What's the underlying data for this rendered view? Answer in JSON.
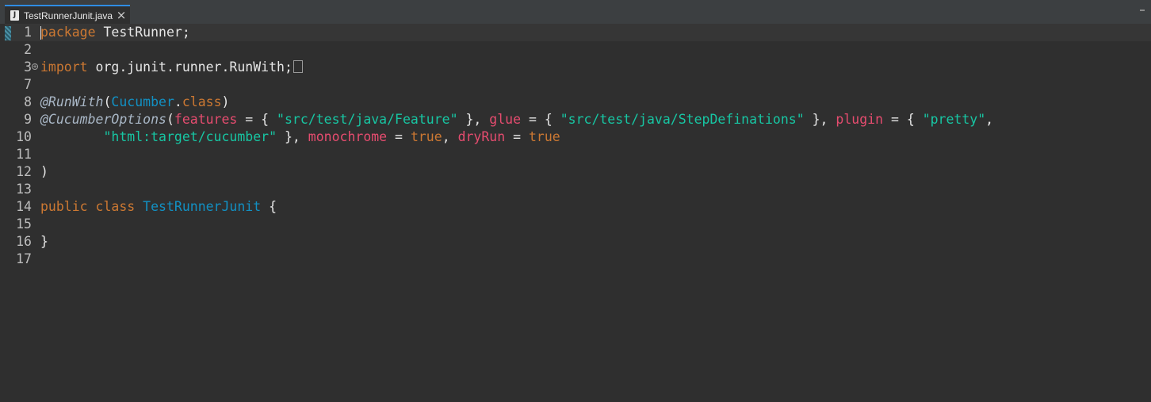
{
  "tab": {
    "title": "TestRunnerJunit.java",
    "icon": "J",
    "close": "×"
  },
  "editor": {
    "lines": [
      {
        "num": "1",
        "tokens": [
          [
            "kw",
            "package"
          ],
          [
            "txt",
            " TestRunner;"
          ]
        ]
      },
      {
        "num": "2",
        "tokens": []
      },
      {
        "num": "3",
        "folded": true,
        "tokens": [
          [
            "kw",
            "import"
          ],
          [
            "txt",
            " org.junit.runner.RunWith;"
          ]
        ]
      },
      {
        "num": "7",
        "tokens": []
      },
      {
        "num": "8",
        "tokens": [
          [
            "ann",
            "@RunWith"
          ],
          [
            "txt",
            "("
          ],
          [
            "type",
            "Cucumber"
          ],
          [
            "txt",
            "."
          ],
          [
            "kw",
            "class"
          ],
          [
            "txt",
            ")"
          ]
        ]
      },
      {
        "num": "9",
        "tokens": [
          [
            "ann",
            "@CucumberOptions"
          ],
          [
            "txt",
            "("
          ],
          [
            "param",
            "features"
          ],
          [
            "txt",
            " = { "
          ],
          [
            "str",
            "\"src/test/java/Feature\""
          ],
          [
            "txt",
            " }, "
          ],
          [
            "param",
            "glue"
          ],
          [
            "txt",
            " = { "
          ],
          [
            "str",
            "\"src/test/java/StepDefinations\""
          ],
          [
            "txt",
            " }, "
          ],
          [
            "param",
            "plugin"
          ],
          [
            "txt",
            " = { "
          ],
          [
            "str",
            "\"pretty\""
          ],
          [
            "txt",
            ","
          ]
        ]
      },
      {
        "num": "10",
        "tokens": [
          [
            "txt",
            "        "
          ],
          [
            "str",
            "\"html:target/cucumber\""
          ],
          [
            "txt",
            " }, "
          ],
          [
            "param",
            "monochrome"
          ],
          [
            "txt",
            " = "
          ],
          [
            "kw",
            "true"
          ],
          [
            "txt",
            ", "
          ],
          [
            "param",
            "dryRun"
          ],
          [
            "txt",
            " = "
          ],
          [
            "kw",
            "true"
          ]
        ]
      },
      {
        "num": "11",
        "tokens": []
      },
      {
        "num": "12",
        "tokens": [
          [
            "txt",
            ")"
          ]
        ]
      },
      {
        "num": "13",
        "tokens": []
      },
      {
        "num": "14",
        "tokens": [
          [
            "kw",
            "public"
          ],
          [
            "txt",
            " "
          ],
          [
            "kw",
            "class"
          ],
          [
            "txt",
            " "
          ],
          [
            "type",
            "TestRunnerJunit"
          ],
          [
            "txt",
            " {"
          ]
        ]
      },
      {
        "num": "15",
        "tokens": []
      },
      {
        "num": "16",
        "tokens": [
          [
            "txt",
            "}"
          ]
        ]
      },
      {
        "num": "17",
        "tokens": []
      }
    ]
  },
  "colors": {
    "background": "#2f2f2f",
    "keyword": "#cc7832",
    "type": "#1290c3",
    "string": "#17c6a3",
    "parameter": "#e64c6f",
    "tab_accent": "#2f8de4"
  }
}
